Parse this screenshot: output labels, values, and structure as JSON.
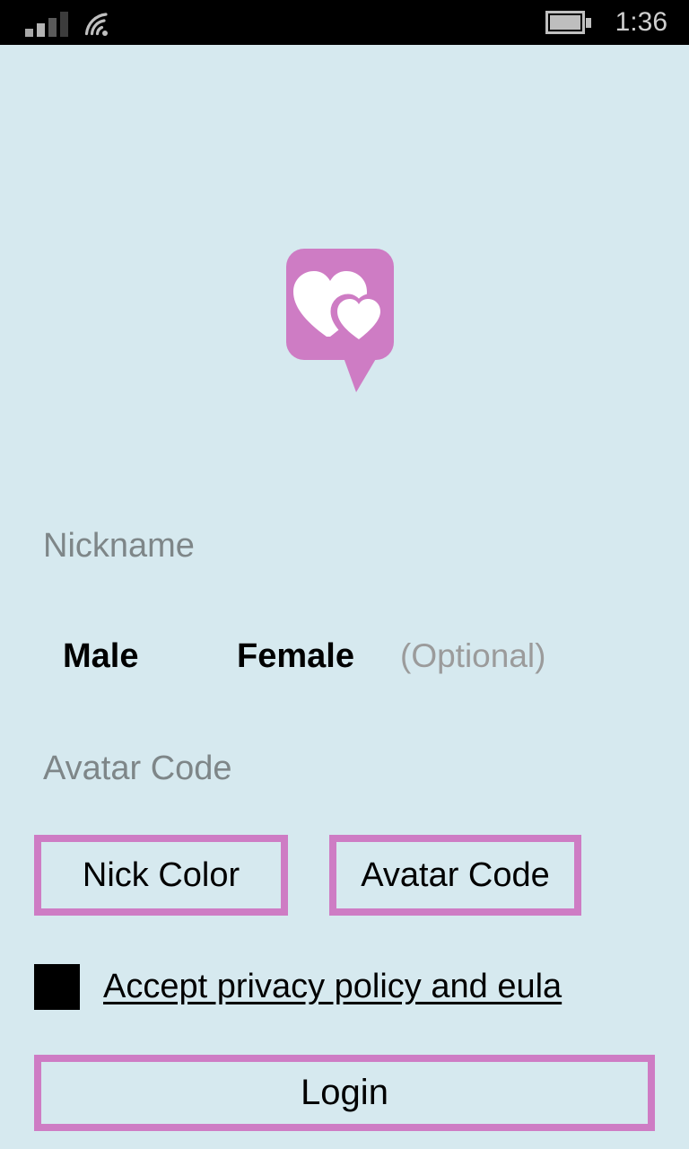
{
  "status_bar": {
    "signal_icon": "signal-bars-icon",
    "wifi_icon": "wifi-icon",
    "battery_icon": "battery-icon",
    "time": "1:36"
  },
  "logo": {
    "icon": "chat-bubble-hearts-logo",
    "brand_color": "#ce7cc4"
  },
  "form": {
    "nickname": {
      "placeholder": "Nickname",
      "value": ""
    },
    "gender": {
      "male_label": "Male",
      "female_label": "Female",
      "optional_note": "(Optional)"
    },
    "avatar_code": {
      "placeholder": "Avatar Code",
      "value": ""
    },
    "nick_color_label": "Nick Color",
    "avatar_code_label": "Avatar Code",
    "privacy_link_label": "Accept privacy policy and eula",
    "privacy_checkbox_state": "unchecked",
    "login_label": "Login"
  },
  "colors": {
    "background": "#d6e9ef",
    "accent_pink": "#ce7cc4",
    "status_bar": "#000000",
    "placeholder_gray": "#7e8688"
  }
}
